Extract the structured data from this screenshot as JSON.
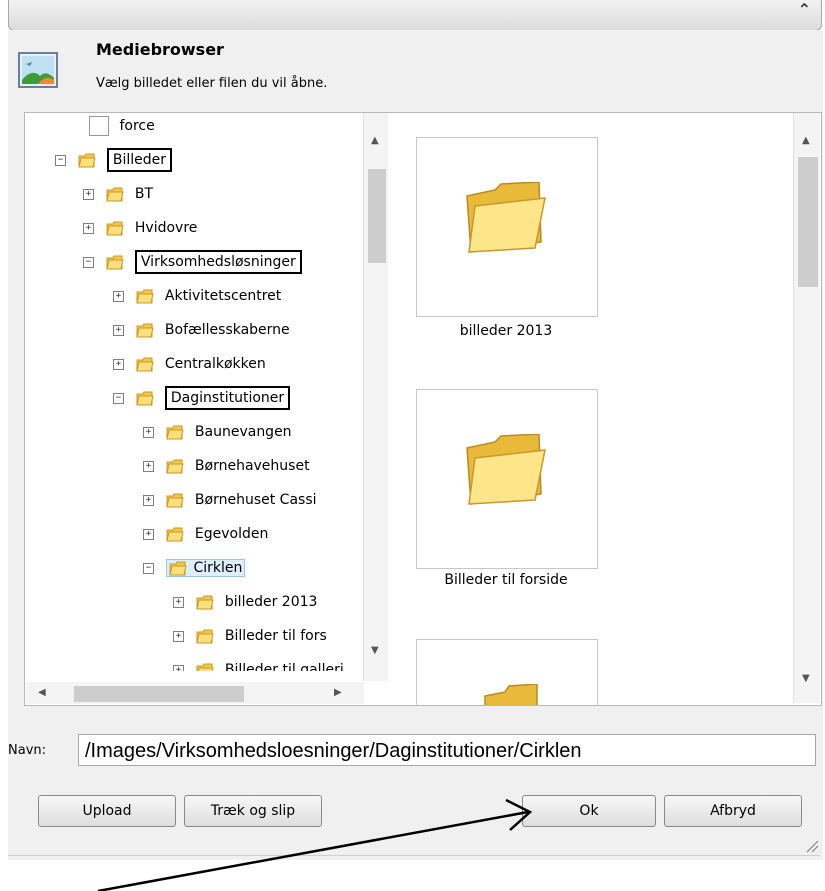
{
  "header": {
    "title": "Mediebrowser",
    "subtitle": "Vælg billedet eller filen du vil åbne."
  },
  "tree": {
    "nodes": [
      {
        "label": "force"
      },
      {
        "label": "Billeder"
      },
      {
        "label": "BT"
      },
      {
        "label": "Hvidovre"
      },
      {
        "label": "Virksomhedsløsninger"
      },
      {
        "label": "Aktivitetscentret"
      },
      {
        "label": "Bofællesskaberne"
      },
      {
        "label": "Centralkøkken"
      },
      {
        "label": "Daginstitutioner"
      },
      {
        "label": "Baunevangen"
      },
      {
        "label": "Børnehavehuset"
      },
      {
        "label": "Børnehuset Cassi"
      },
      {
        "label": "Egevolden"
      },
      {
        "label": "Cirklen"
      },
      {
        "label": "billeder 2013"
      },
      {
        "label": "Billeder til fors"
      },
      {
        "label": "Billeder til galleri"
      }
    ]
  },
  "content": {
    "tiles": [
      {
        "caption": "billeder 2013"
      },
      {
        "caption": "Billeder til forside"
      },
      {
        "caption": ""
      }
    ]
  },
  "name_field": {
    "label": "Navn:",
    "value": "/Images/Virksomhedsloesninger/Daginstitutioner/Cirklen"
  },
  "buttons": {
    "upload": "Upload",
    "drag_drop": "Træk og slip",
    "ok": "Ok",
    "cancel": "Afbryd"
  },
  "colors": {
    "folder": "#f5c842",
    "selection": "#ddeeff",
    "annotation": "#000000"
  }
}
